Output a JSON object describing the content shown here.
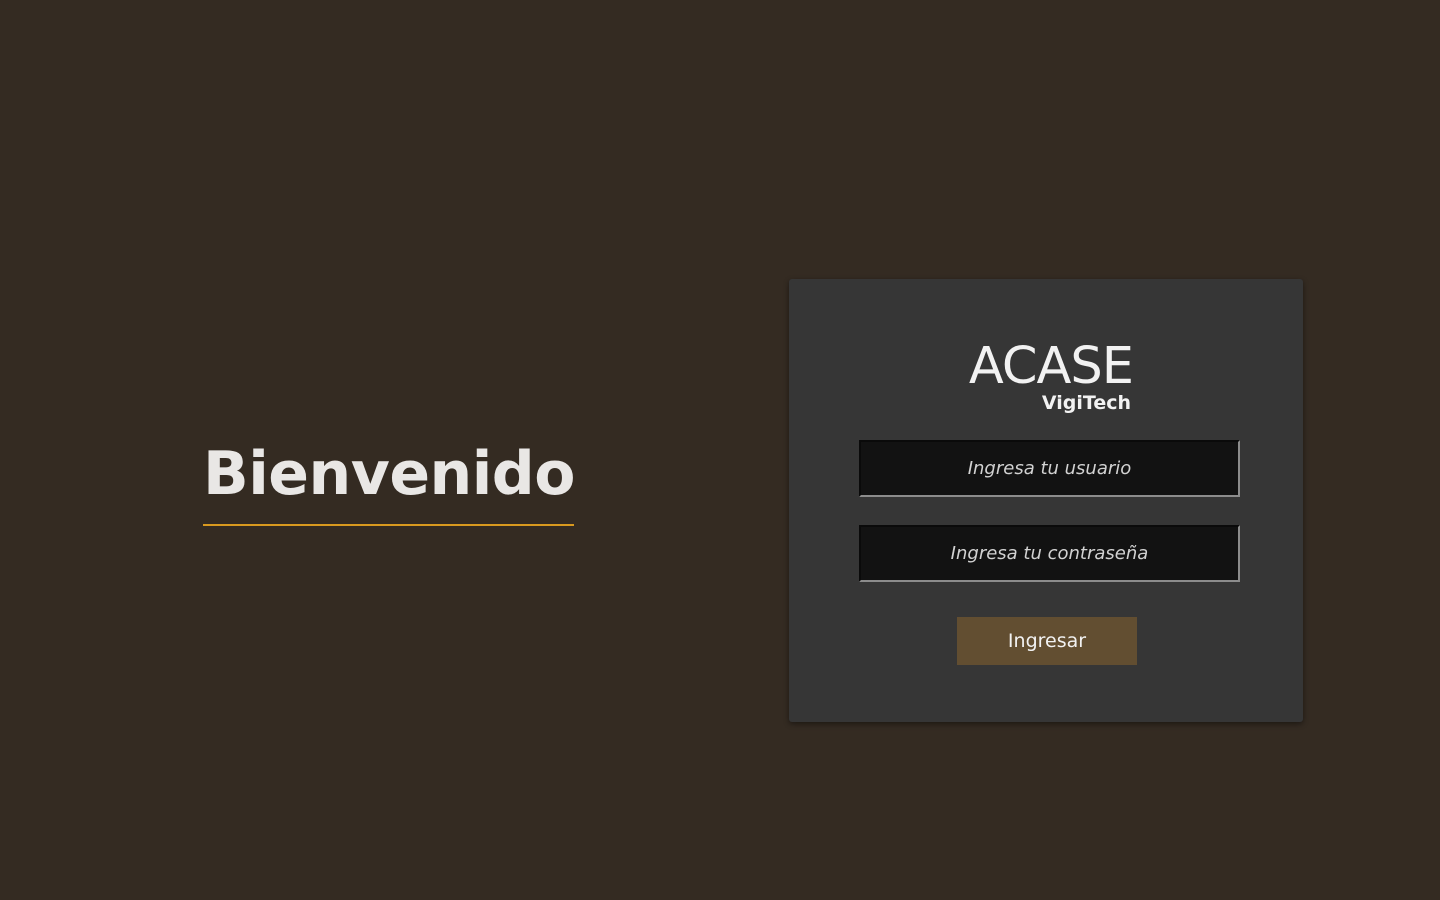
{
  "welcome": {
    "title": "Bienvenido"
  },
  "login": {
    "logo_main": "ACASE",
    "logo_sub": "VigiTech",
    "username_placeholder": "Ingresa tu usuario",
    "password_placeholder": "Ingresa tu contraseña",
    "submit_label": "Ingresar"
  },
  "colors": {
    "background": "#342b22",
    "card": "#363636",
    "accent_underline": "#d8991f",
    "button": "#624e31",
    "input_bg": "#121212"
  }
}
